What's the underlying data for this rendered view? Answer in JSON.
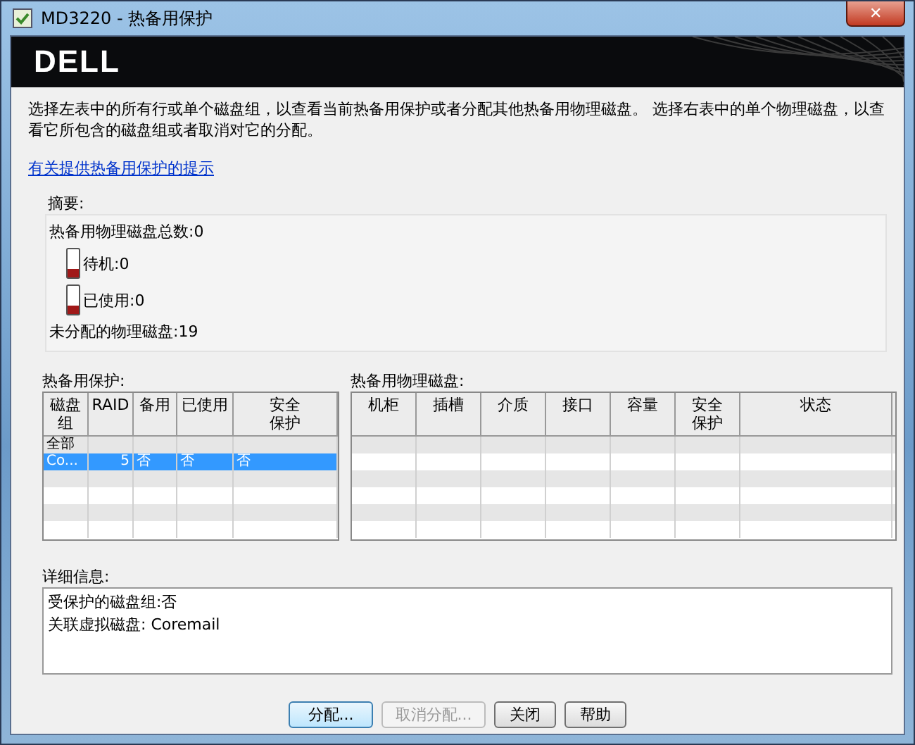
{
  "window": {
    "title": "MD3220 - 热备用保护",
    "close": "✕"
  },
  "logo": "DELL",
  "instructions": "选择左表中的所有行或单个磁盘组，以查看当前热备用保护或者分配其他热备用物理磁盘。 选择右表中的单个物理磁盘，以查看它所包含的磁盘组或者取消对它的分配。",
  "help_link": "有关提供热备用保护的提示",
  "summary": {
    "title": "摘要:",
    "total": "热备用物理磁盘总数:0",
    "items": [
      {
        "label": "待机:0"
      },
      {
        "label": "已使用:0"
      }
    ],
    "unassigned": "未分配的物理磁盘:19"
  },
  "protection_table": {
    "title": "热备用保护:",
    "columns": [
      "磁盘组",
      "RAID",
      "备用",
      "已使用",
      "安全保护"
    ],
    "rows": [
      {
        "cells": [
          "全部",
          "",
          "",
          "",
          ""
        ],
        "selected": false
      },
      {
        "cells": [
          "Co...",
          "5",
          "否",
          "否",
          "否"
        ],
        "selected": true
      }
    ]
  },
  "disk_table": {
    "title": "热备用物理磁盘:",
    "columns": [
      "机柜",
      "插槽",
      "介质",
      "接口",
      "容量",
      "安全保护",
      "状态"
    ]
  },
  "details": {
    "title": "详细信息:",
    "lines": [
      "受保护的磁盘组:否",
      "关联虚拟磁盘: Coremail"
    ]
  },
  "buttons": [
    {
      "label": "分配...",
      "disabled": false,
      "default": true
    },
    {
      "label": "取消分配...",
      "disabled": true,
      "default": false
    },
    {
      "label": "关闭",
      "disabled": false,
      "default": false
    },
    {
      "label": "帮助",
      "disabled": false,
      "default": false
    }
  ]
}
